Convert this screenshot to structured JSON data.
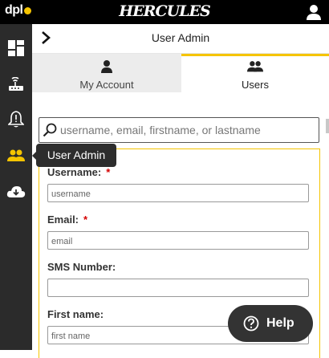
{
  "app": {
    "logo_text": "dpl",
    "brand": "HERCULES",
    "profile_icon": "user-icon"
  },
  "sidebar": {
    "items": [
      {
        "icon": "dashboard-icon",
        "active": false
      },
      {
        "icon": "router-icon",
        "active": false
      },
      {
        "icon": "alert-bell-icon",
        "active": false
      },
      {
        "icon": "users-icon",
        "active": true
      },
      {
        "icon": "cloud-download-icon",
        "active": false
      }
    ],
    "tooltip": "User Admin"
  },
  "header": {
    "title": "User Admin",
    "back_icon": "chevron-right-icon"
  },
  "tabs": [
    {
      "label": "My Account",
      "icon": "person-icon",
      "selected": false
    },
    {
      "label": "Users",
      "icon": "people-icon",
      "selected": true
    }
  ],
  "search": {
    "placeholder": "username, email, firstname, or lastname",
    "icon": "search-icon"
  },
  "form": {
    "fields": [
      {
        "label": "Username:",
        "required": "*",
        "placeholder": "username"
      },
      {
        "label": "Email:",
        "required": "*",
        "placeholder": "email"
      },
      {
        "label": "SMS Number:",
        "required": "",
        "placeholder": ""
      },
      {
        "label": "First name:",
        "required": "",
        "placeholder": "first name"
      }
    ]
  },
  "help": {
    "label": "Help",
    "icon": "question-circle-icon"
  },
  "colors": {
    "accent": "#f5c400",
    "topbar": "#000000",
    "sidebar": "#2b2b2b",
    "required": "#d40000"
  }
}
